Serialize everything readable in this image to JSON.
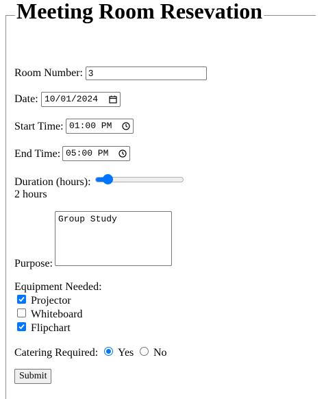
{
  "form": {
    "legend": "Meeting Room Resevation",
    "room": {
      "label": "Room Number:",
      "value": "3"
    },
    "date": {
      "label": "Date:",
      "value": "10/01/2024"
    },
    "start_time": {
      "label": "Start Time:",
      "value": "01:00 PM"
    },
    "end_time": {
      "label": "End Time:",
      "value": "05:00 PM"
    },
    "duration": {
      "label": "Duration (hours):",
      "value_text": "2 hours",
      "level_fraction": 0.1
    },
    "purpose": {
      "label": "Purpose:",
      "value": "Group Study"
    },
    "equipment": {
      "label": "Equipment Needed:",
      "items": [
        {
          "label": "Projector",
          "checked": true
        },
        {
          "label": "Whiteboard",
          "checked": false
        },
        {
          "label": "Flipchart",
          "checked": true
        }
      ]
    },
    "catering": {
      "label": "Catering Required:",
      "options": [
        {
          "label": "Yes",
          "selected": true
        },
        {
          "label": "No",
          "selected": false
        }
      ]
    },
    "submit_label": "Submit"
  },
  "colors": {
    "accent": "#0075ff",
    "border": "#767676",
    "text": "#000000",
    "button_bg": "#efefef"
  },
  "icons": {
    "date_picker": "calendar-icon",
    "time_picker": "clock-icon",
    "checkbox_mark": "check-icon"
  }
}
